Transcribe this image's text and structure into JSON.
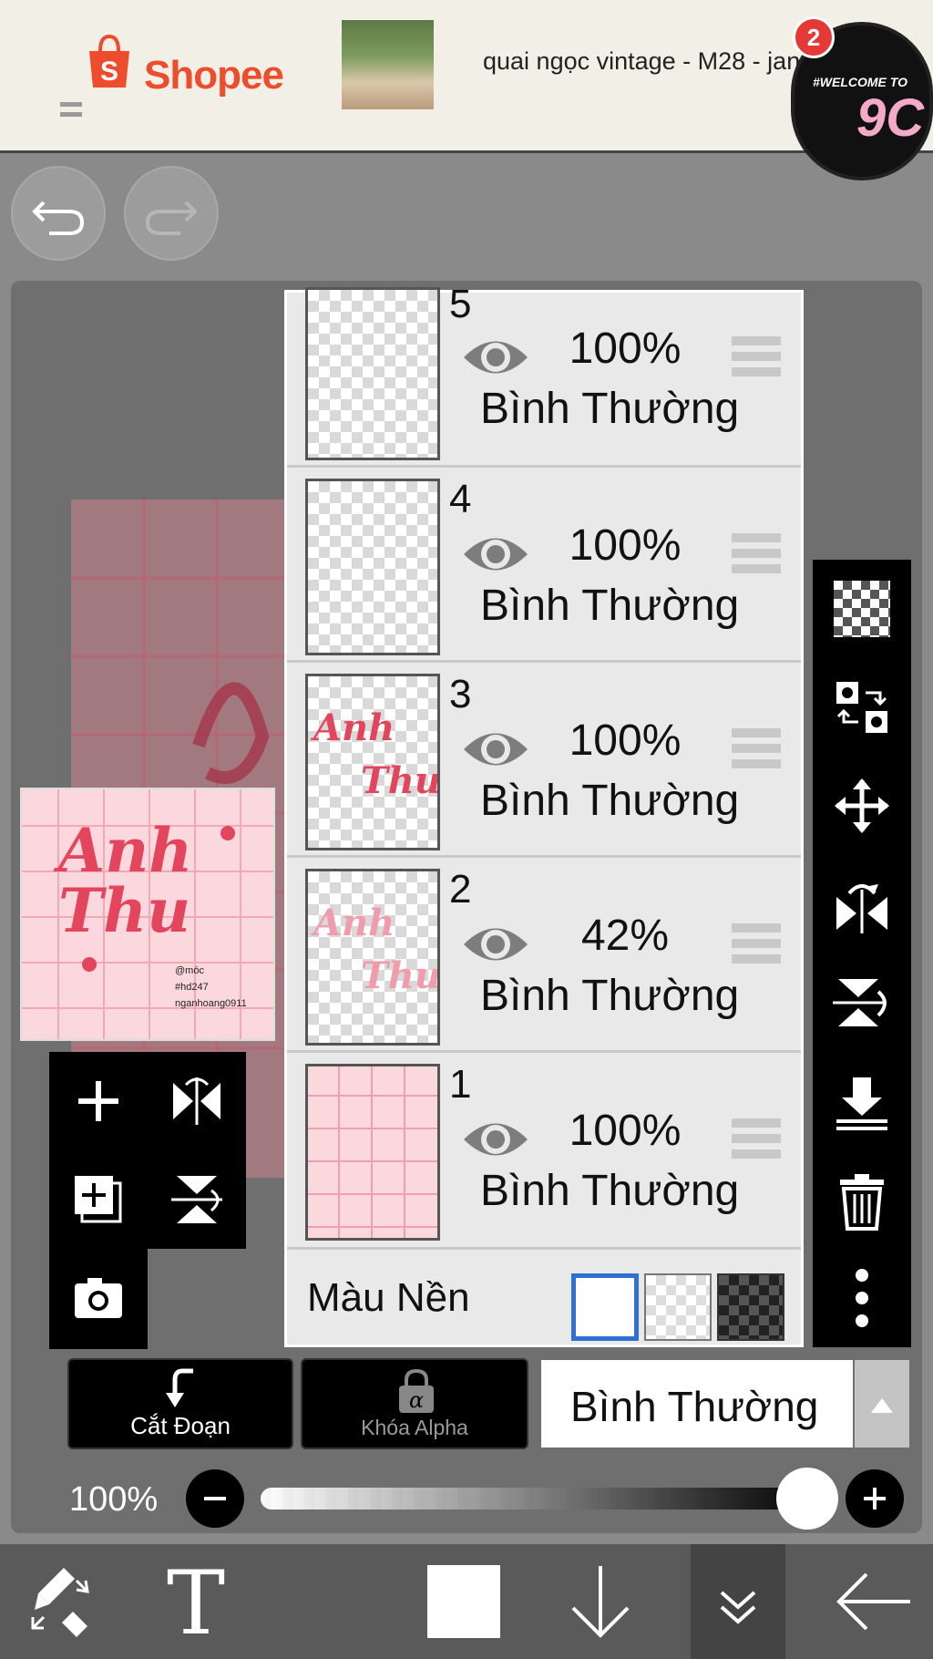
{
  "ad": {
    "brand": "Shopee",
    "product_name": "quai ngọc vintage - M28 - jan",
    "notification_count": "2",
    "bubble_line1": "#WELCOME TO",
    "bubble_line2": "9C"
  },
  "canvas": {
    "thumbnail_text_main": "Anh\nThu",
    "thumbnail_text_small": "@móc\n#hd247\nnganhoang0911"
  },
  "layers": [
    {
      "number": "5",
      "opacity": "100%",
      "mode": "Bình Thường"
    },
    {
      "number": "4",
      "opacity": "100%",
      "mode": "Bình Thường"
    },
    {
      "number": "3",
      "opacity": "100%",
      "mode": "Bình Thường"
    },
    {
      "number": "2",
      "opacity": "42%",
      "mode": "Bình Thường"
    },
    {
      "number": "1",
      "opacity": "100%",
      "mode": "Bình Thường"
    }
  ],
  "background": {
    "label": "Màu Nền"
  },
  "actions": {
    "cut_label": "Cắt Đoạn",
    "alpha_lock_label": "Khóa Alpha",
    "blend_mode": "Bình Thường"
  },
  "opacity": {
    "label": "100%",
    "value": 0.88
  },
  "colors": {
    "accent_blue": "#2f6fd6",
    "shopee_orange": "#ee4d2d"
  }
}
